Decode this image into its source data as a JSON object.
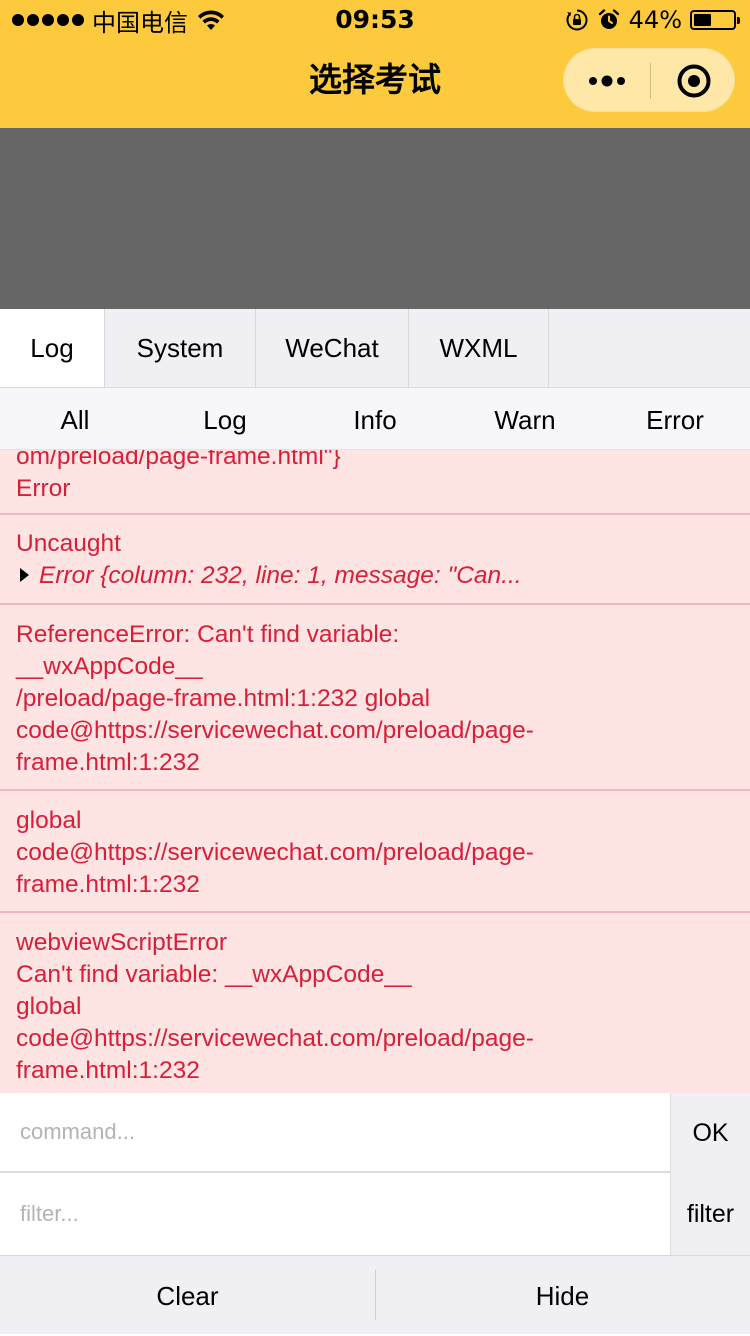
{
  "status_bar": {
    "carrier": "中国电信",
    "time": "09:53",
    "battery_percent_label": "44%",
    "battery_level": 0.44,
    "icons": [
      "signal-dots-icon",
      "wifi-icon",
      "orientation-lock-icon",
      "alarm-icon",
      "battery-icon"
    ]
  },
  "nav": {
    "title": "选择考试",
    "background": "#fcca3c",
    "capsule": {
      "more_icon": "more-dots-icon",
      "close_icon": "close-target-icon"
    }
  },
  "console": {
    "tabs": [
      {
        "label": "Log",
        "active": true
      },
      {
        "label": "System",
        "active": false
      },
      {
        "label": "WeChat",
        "active": false
      },
      {
        "label": "WXML",
        "active": false
      }
    ],
    "subtabs": [
      "All",
      "Log",
      "Info",
      "Warn",
      "Error"
    ],
    "error_color": "#d72038",
    "logs": [
      {
        "lines": [
          "om/preload/page-frame.html\"}",
          "Error"
        ]
      },
      {
        "lines": [
          "Uncaught"
        ],
        "object": "Error {column: 232, line: 1, message: \"Can..."
      },
      {
        "lines": [
          "ReferenceError: Can't find variable:",
          "__wxAppCode__",
          "/preload/page-frame.html:1:232 global",
          "code@https://servicewechat.com/preload/page-",
          "frame.html:1:232"
        ]
      },
      {
        "lines": [
          "global",
          "code@https://servicewechat.com/preload/page-",
          "frame.html:1:232"
        ]
      },
      {
        "lines": [
          "webviewScriptError",
          "Can't find variable: __wxAppCode__",
          "global",
          "code@https://servicewechat.com/preload/page-",
          "frame.html:1:232"
        ]
      }
    ],
    "command": {
      "placeholder": "command...",
      "button_label": "OK"
    },
    "filter": {
      "placeholder": "filter...",
      "button_label": "filter"
    },
    "toolbar": {
      "clear_label": "Clear",
      "hide_label": "Hide"
    }
  }
}
